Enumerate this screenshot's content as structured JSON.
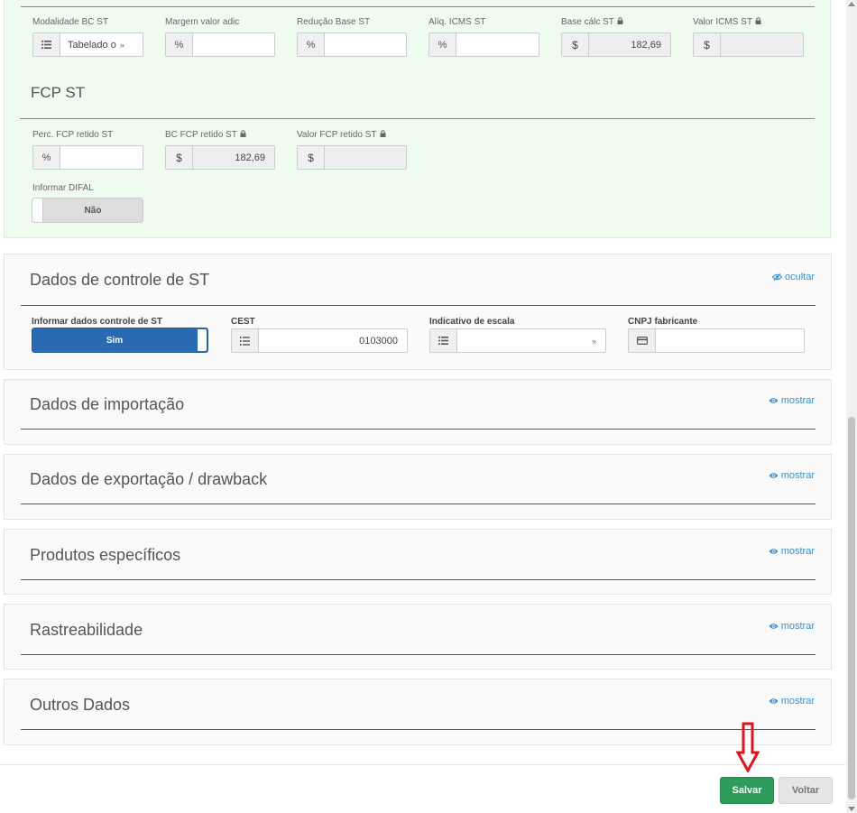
{
  "icms_st": {
    "fields": [
      {
        "label": "Modalidade BC ST",
        "addon": "list-icon",
        "value": "Tabelado o",
        "locked": false
      },
      {
        "label": "Margem valor adic",
        "addon": "%",
        "value": "",
        "locked": false
      },
      {
        "label": "Redução Base ST",
        "addon": "%",
        "value": "",
        "locked": false
      },
      {
        "label": "Alíq. ICMS ST",
        "addon": "%",
        "value": "",
        "locked": false
      },
      {
        "label": "Base cálc ST",
        "addon": "$",
        "value": "182,69",
        "locked": true
      },
      {
        "label": "Valor ICMS ST",
        "addon": "$",
        "value": "",
        "locked": true
      }
    ]
  },
  "fcp_st": {
    "title": "FCP ST",
    "fields": [
      {
        "label": "Perc. FCP retido ST",
        "addon": "%",
        "value": ""
      },
      {
        "label": "BC FCP retido ST",
        "addon": "$",
        "value": "182,69"
      },
      {
        "label": "Valor FCP retido ST",
        "addon": "$",
        "value": ""
      }
    ],
    "difal_label": "Informar DIFAL",
    "difal_value": "Não"
  },
  "controle_st": {
    "title": "Dados de controle de ST",
    "link": "ocultar",
    "informar_label": "Informar dados controle de ST",
    "informar_value": "Sim",
    "cest_label": "CEST",
    "cest_value": "0103000",
    "escala_label": "Indicativo de escala",
    "escala_value": "",
    "cnpj_label": "CNPJ fabricante",
    "cnpj_value": ""
  },
  "sections": [
    {
      "title": "Dados de importação",
      "link": "mostrar"
    },
    {
      "title": "Dados de exportação / drawback",
      "link": "mostrar"
    },
    {
      "title": "Produtos específicos",
      "link": "mostrar"
    },
    {
      "title": "Rastreabilidade",
      "link": "mostrar"
    },
    {
      "title": "Outros Dados",
      "link": "mostrar"
    }
  ],
  "buttons": {
    "save": "Salvar",
    "back": "Voltar"
  },
  "colors": {
    "save": "#2e9c5a",
    "toggle_on": "#2a6ab3",
    "link": "#3a8fd0",
    "annotation_arrow": "#e0141e"
  }
}
